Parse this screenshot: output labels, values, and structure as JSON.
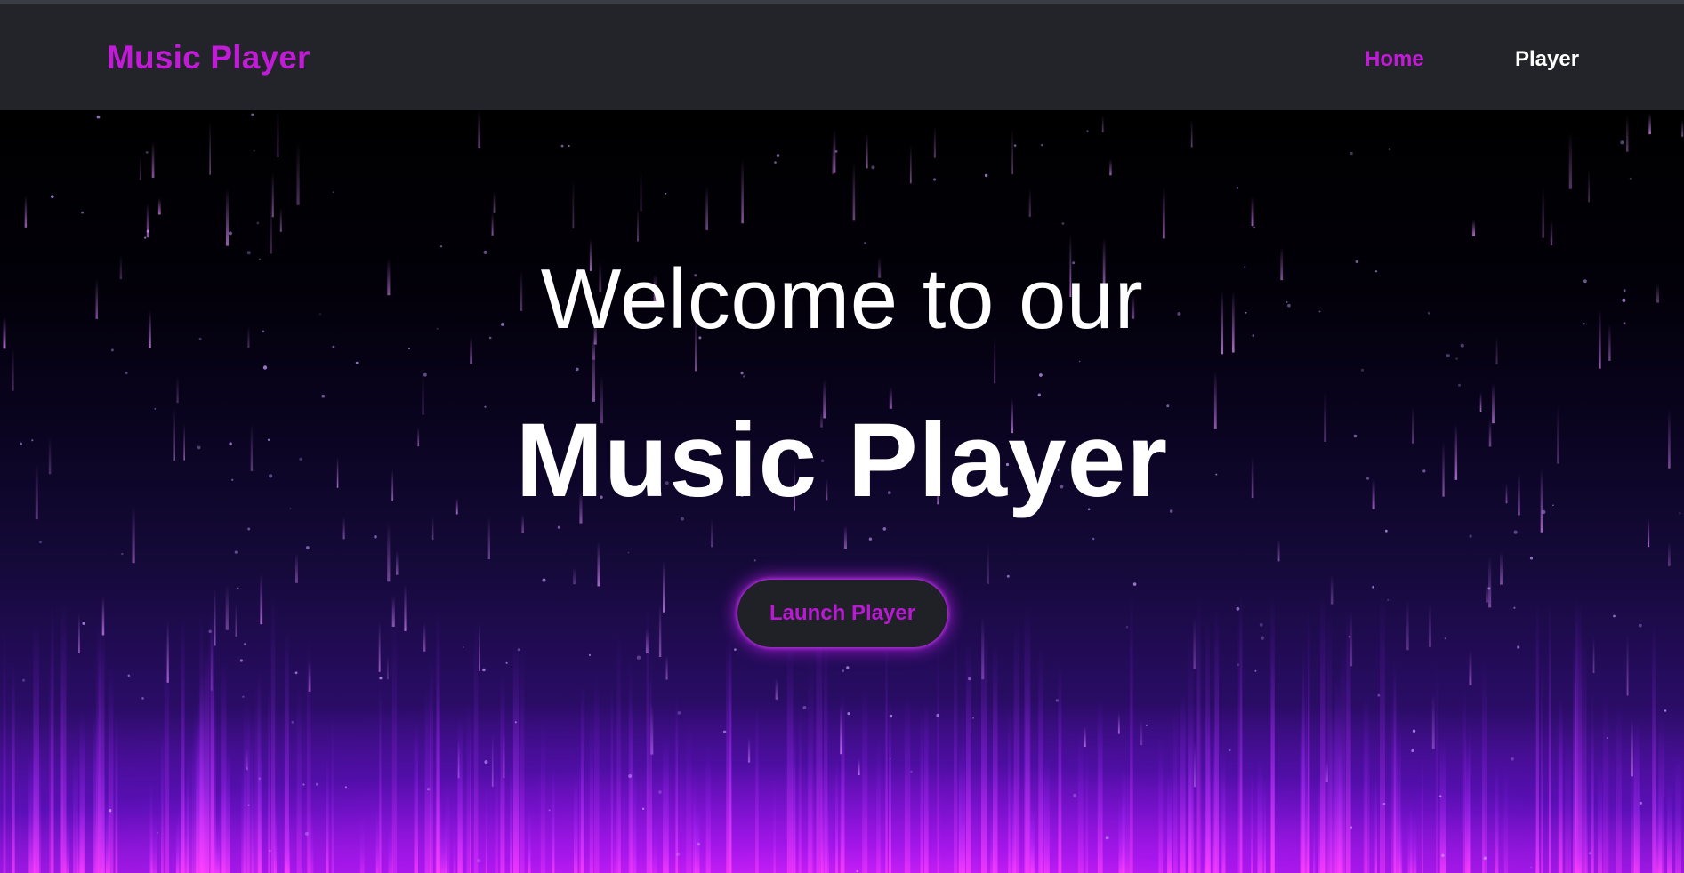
{
  "header": {
    "brand": "Music Player",
    "nav": [
      {
        "label": "Home",
        "color": "#c21bd8",
        "active": true
      },
      {
        "label": "Player",
        "color": "#ffffff",
        "active": false
      }
    ]
  },
  "hero": {
    "welcome_text": "Welcome to our",
    "title": "Music Player",
    "button_label": "Launch Player"
  },
  "colors": {
    "accent": "#c21bd8",
    "header_bg": "#23242a",
    "button_bg": "#202127"
  }
}
